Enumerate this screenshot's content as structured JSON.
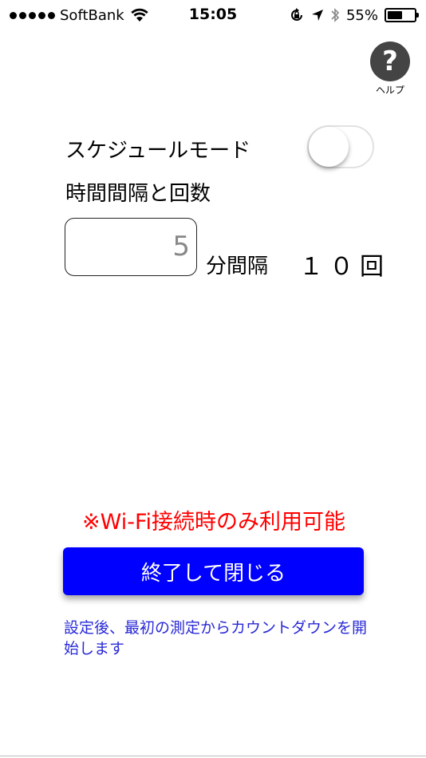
{
  "status_bar": {
    "carrier": "SoftBank",
    "time": "15:05",
    "battery_percent": "55%",
    "battery_level": 0.55,
    "icons": [
      "signal-dots",
      "wifi-icon",
      "orientation-lock-icon",
      "location-icon",
      "bluetooth-icon",
      "battery-icon"
    ]
  },
  "help": {
    "icon_glyph": "?",
    "label": "ヘルプ"
  },
  "schedule": {
    "mode_label": "スケジュールモード",
    "toggle_on": false
  },
  "interval": {
    "section_label": "時間間隔と回数",
    "value": "5",
    "unit_label": "分間隔",
    "count_label": "１０回"
  },
  "notice": {
    "wifi_only": "※Wi-Fi接続時のみ利用可能"
  },
  "actions": {
    "finish_close_label": "終了して閉じる"
  },
  "footnote": {
    "text": "設定後、最初の測定からカウントダウンを開始します"
  },
  "colors": {
    "accent_button": "#0000ff",
    "warning_text": "#ff0000",
    "footnote_text": "#2a2ad8"
  }
}
